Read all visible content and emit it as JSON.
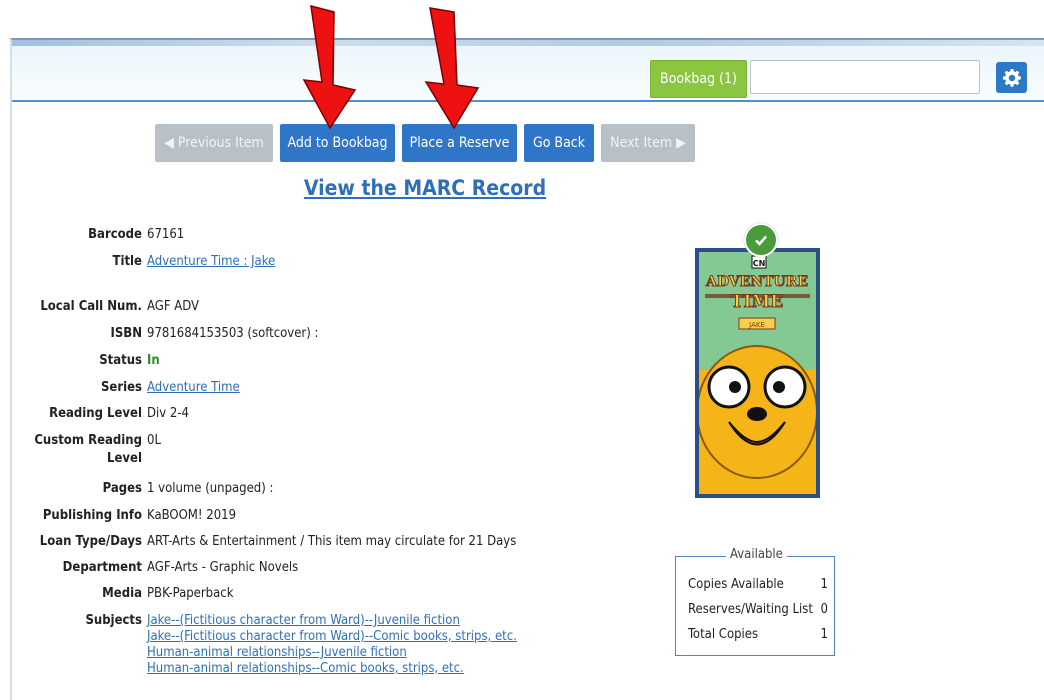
{
  "header": {
    "bookbag_label": "Bookbag (1)",
    "search_value": ""
  },
  "nav": {
    "previous_label": "◀ Previous Item",
    "add_bookbag_label": "Add to Bookbag",
    "place_reserve_label": "Place a Reserve",
    "go_back_label": "Go Back",
    "next_label": "Next Item ▶"
  },
  "marc_link": "View the MARC Record",
  "details": {
    "barcode": {
      "label": "Barcode",
      "value": "67161"
    },
    "title": {
      "label": "Title",
      "value": "Adventure Time : Jake"
    },
    "local_call": {
      "label": "Local Call Num.",
      "value": "AGF ADV"
    },
    "isbn": {
      "label": "ISBN",
      "value": "9781684153503 (softcover) :"
    },
    "status": {
      "label": "Status",
      "value": "In"
    },
    "series": {
      "label": "Series",
      "value": "Adventure Time"
    },
    "reading_level": {
      "label": "Reading Level",
      "value": "Div 2-4"
    },
    "custom_reading": {
      "label1": "Custom Reading",
      "label2": "Level",
      "value": "0L"
    },
    "pages": {
      "label": "Pages",
      "value": "1 volume (unpaged) :"
    },
    "publishing": {
      "label": "Publishing Info",
      "value": "KaBOOM! 2019"
    },
    "loan": {
      "label": "Loan Type/Days",
      "value": "ART-Arts & Entertainment / This item may circulate for 21 Days"
    },
    "department": {
      "label": "Department",
      "value": "AGF-Arts - Graphic Novels"
    },
    "media": {
      "label": "Media",
      "value": "PBK-Paperback"
    },
    "subjects": {
      "label": "Subjects",
      "items": [
        "Jake--(Fictitious character from Ward)--Juvenile fiction",
        "Jake--(Fictitious character from Ward)--Comic books, strips, etc.",
        "Human-animal relationships--Juvenile fiction",
        "Human-animal relationships--Comic books, strips, etc."
      ]
    }
  },
  "cover": {
    "brand": "CN",
    "title_line1": "ADVENTURE",
    "title_line2": "TIME",
    "subtitle": "JAKE"
  },
  "availability": {
    "legend": "Available",
    "rows": [
      {
        "label": "Copies Available",
        "value": "1"
      },
      {
        "label": "Reserves/Waiting List",
        "value": "0"
      },
      {
        "label": "Total Copies",
        "value": "1"
      }
    ]
  },
  "colors": {
    "primary_button": "#2f76c8",
    "bookbag_button": "#8cc540",
    "disabled_button": "#b9c0c7",
    "link": "#2f6fb8",
    "status_in": "#2f8a2f",
    "annotation_arrow": "#ee1111"
  }
}
